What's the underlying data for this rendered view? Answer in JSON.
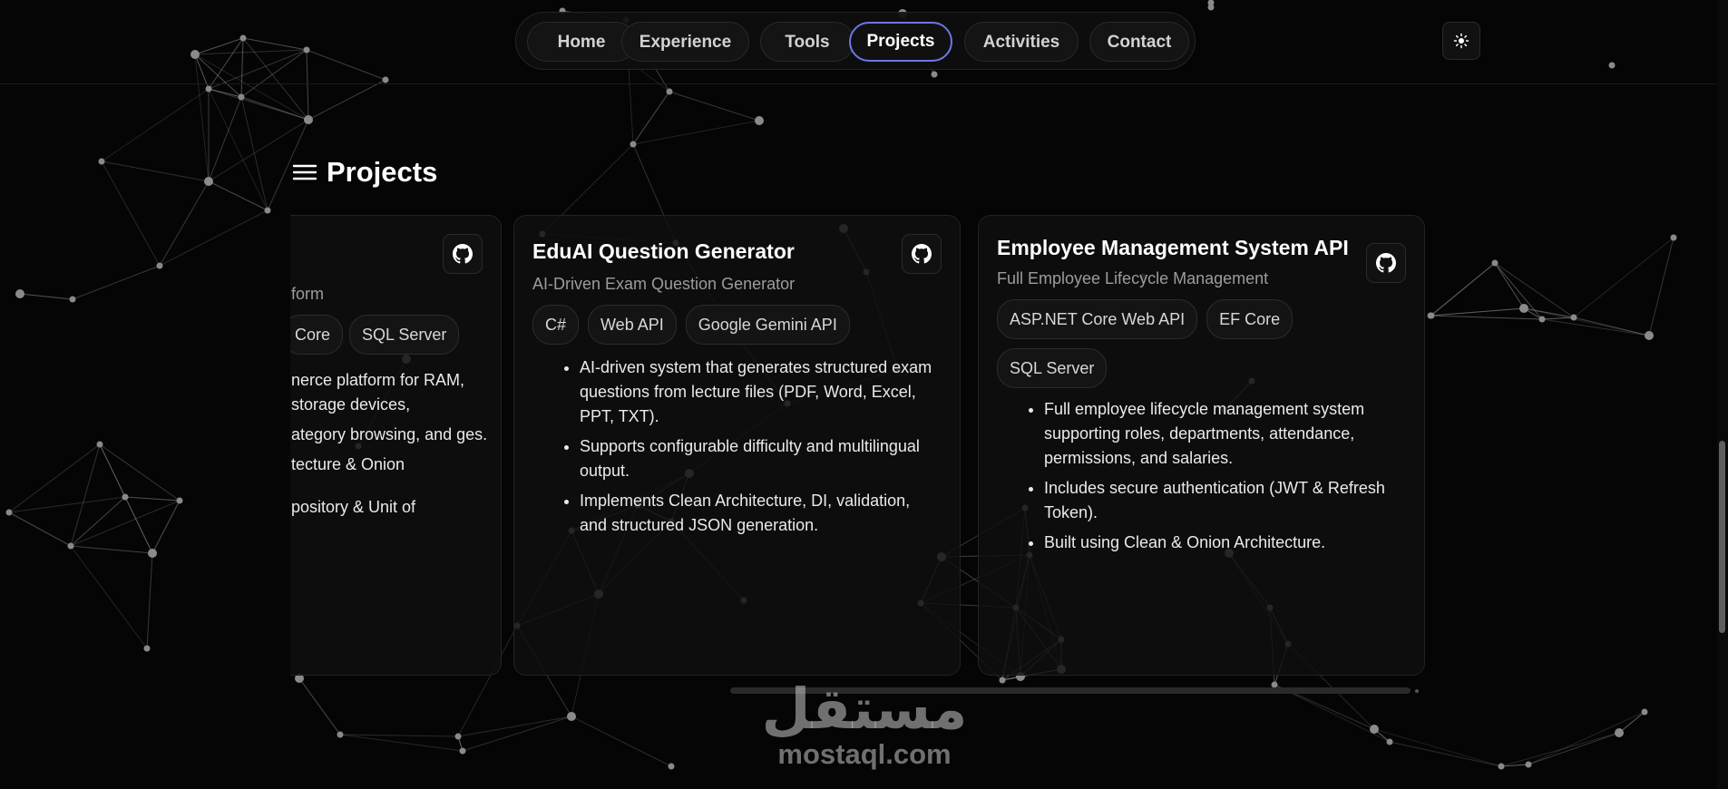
{
  "nav": {
    "items": [
      {
        "label": "Home"
      },
      {
        "label": "Experience"
      },
      {
        "label": "Tools"
      },
      {
        "label": "Projects",
        "active": true
      },
      {
        "label": "Activities"
      },
      {
        "label": "Contact"
      }
    ],
    "accent_color": "#6a78e8"
  },
  "theme_toggle": {
    "icon": "sun-icon"
  },
  "section": {
    "title": "Projects",
    "icon": "menu-lines-icon"
  },
  "projects": [
    {
      "title": "",
      "subtitle": "form",
      "tags": [
        "Core",
        "SQL Server"
      ],
      "points": [
        "nerce platform for RAM, storage devices,",
        "ategory browsing, and ges.",
        "tecture & Onion",
        "pository & Unit of"
      ],
      "link_icon": "github-icon",
      "partial": true
    },
    {
      "title": "EduAI Question Generator",
      "subtitle": "AI-Driven Exam Question Generator",
      "tags": [
        "C#",
        "Web API",
        "Google Gemini API"
      ],
      "points": [
        "AI-driven system that generates structured exam questions from lecture files (PDF, Word, Excel, PPT, TXT).",
        "Supports configurable difficulty and multilingual output.",
        "Implements Clean Architecture, DI, validation, and structured JSON generation."
      ],
      "link_icon": "github-icon"
    },
    {
      "title": "Employee Management System API",
      "subtitle": "Full Employee Lifecycle Management",
      "tags": [
        "ASP.NET Core Web API",
        "EF Core",
        "SQL Server"
      ],
      "points": [
        "Full employee lifecycle management system supporting roles, departments, attendance, permissions, and salaries.",
        "Includes secure authentication (JWT & Refresh Token).",
        "Built using Clean & Onion Architecture."
      ],
      "link_icon": "github-icon"
    }
  ],
  "watermark": {
    "arabic": "مستقل",
    "latin": "mostaql.com"
  }
}
